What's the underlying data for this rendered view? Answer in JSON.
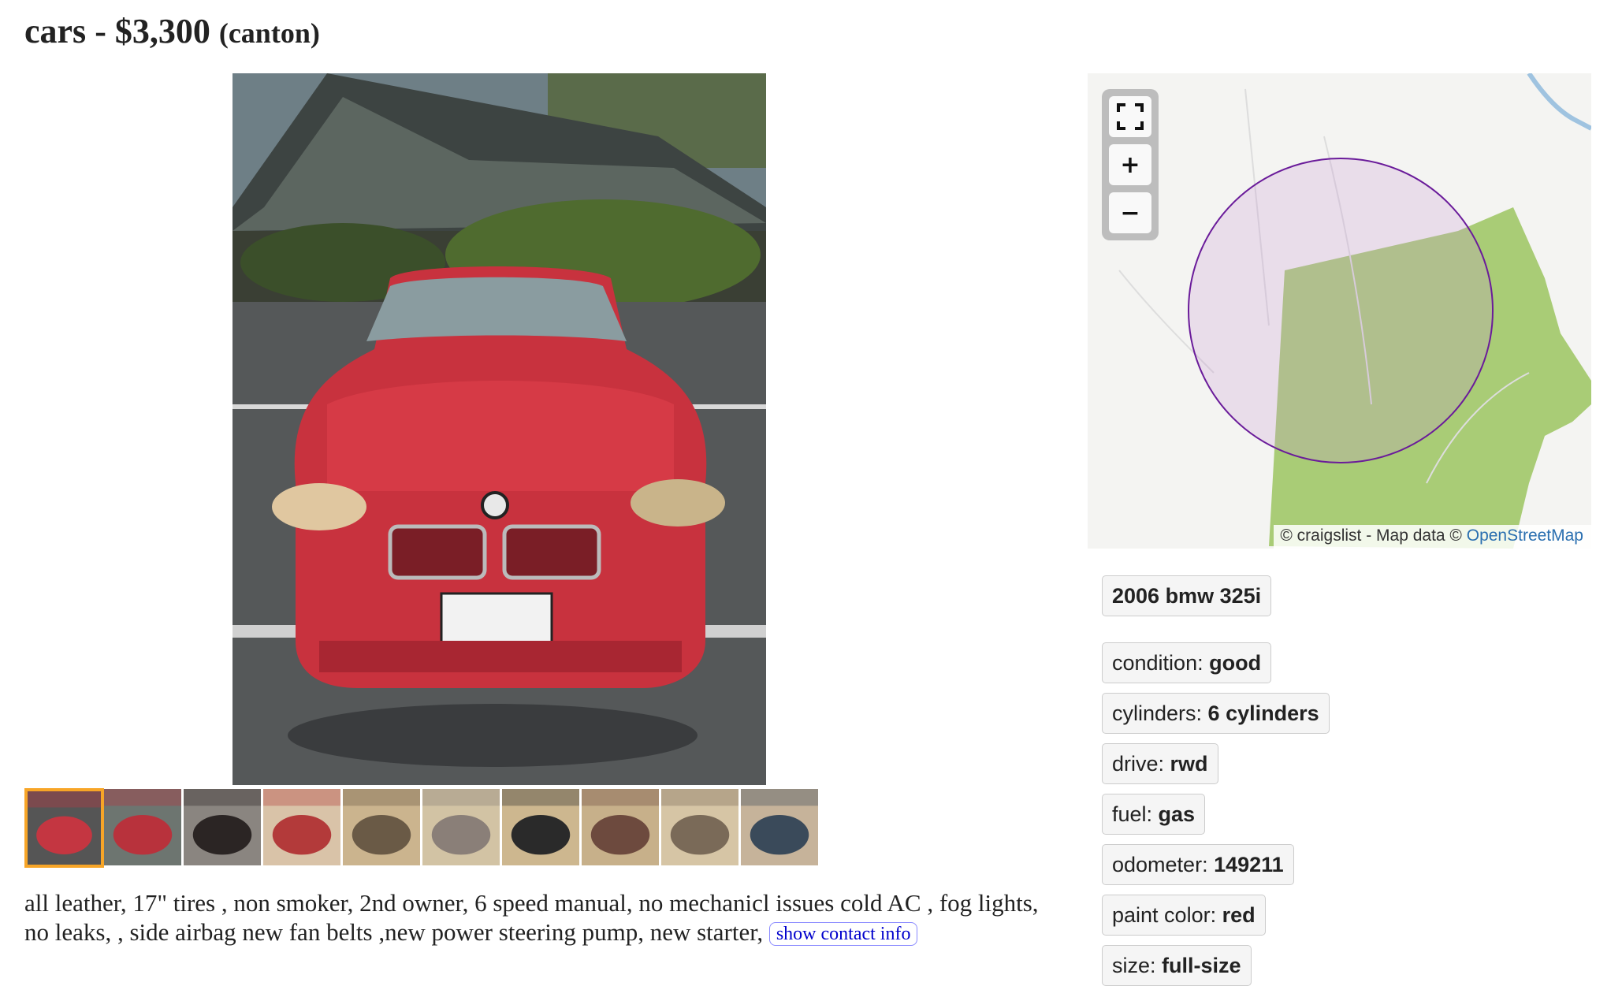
{
  "post": {
    "category": "cars",
    "separator": " - ",
    "price": "$3,300",
    "location": "(canton)"
  },
  "gallery": {
    "thumbnail_count": 10,
    "active_index": 0
  },
  "description": {
    "body": "all leather, 17\" tires , non smoker, 2nd owner, 6 speed manual, no mechanicl issues cold AC , fog lights, no leaks, , side airbag new fan belts ,new power steering pump, new starter, ",
    "contact_button": "show contact info"
  },
  "map": {
    "fullscreen_icon": "fullscreen-icon",
    "zoom_in_label": "+",
    "zoom_out_label": "−",
    "attribution_prefix": "© craigslist - Map data © ",
    "attribution_link": "OpenStreetMap",
    "circle_color": "#6a1b9a",
    "park_color": "#a9cc76"
  },
  "attributes": {
    "title": "2006 bmw 325i",
    "items": [
      {
        "label": "condition: ",
        "value": "good"
      },
      {
        "label": "cylinders: ",
        "value": "6 cylinders"
      },
      {
        "label": "drive: ",
        "value": "rwd"
      },
      {
        "label": "fuel: ",
        "value": "gas"
      },
      {
        "label": "odometer: ",
        "value": "149211"
      },
      {
        "label": "paint color: ",
        "value": "red"
      },
      {
        "label": "size: ",
        "value": "full-size"
      }
    ]
  }
}
